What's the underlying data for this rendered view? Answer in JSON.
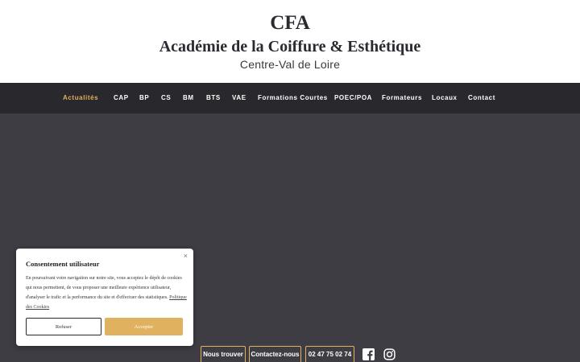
{
  "header": {
    "title": "CFA",
    "subtitle": "Académie de la Coiffure & Esthétique",
    "region": "Centre-Val de Loire"
  },
  "nav": {
    "items": [
      {
        "label": "Actualités",
        "active": true
      },
      {
        "label": "CAP"
      },
      {
        "label": "BP"
      },
      {
        "label": "CS"
      },
      {
        "label": "BM"
      },
      {
        "label": "BTS"
      },
      {
        "label": "VAE"
      },
      {
        "label": "Formations Courtes"
      },
      {
        "label": "POEC/POA"
      },
      {
        "label": "Formateurs"
      },
      {
        "label": "Locaux"
      },
      {
        "label": "Contact"
      }
    ]
  },
  "cookie": {
    "close": "×",
    "title": "Consentement utilisateur",
    "text": "En poursuivant votre navigation sur notre site, vous acceptez le dépôt de cookies qui nous permettent, de vous proposer une meilleure expérience utilisateur, d'analyser le trafic et la performance du site et d'effectuer des statistiques.",
    "link": "Politique des Cookies",
    "refuse": "Refuser",
    "accept": "Accepter"
  },
  "footer": {
    "find_us": "Nous trouver",
    "contact_us": "Contactez-nous",
    "phone": "02 47 75 02 74",
    "icons": [
      "facebook-icon",
      "instagram-icon"
    ]
  },
  "colors": {
    "accent": "#e0b15e",
    "nav_bg": "#29282d",
    "hero_bg": "#3f3d44"
  }
}
